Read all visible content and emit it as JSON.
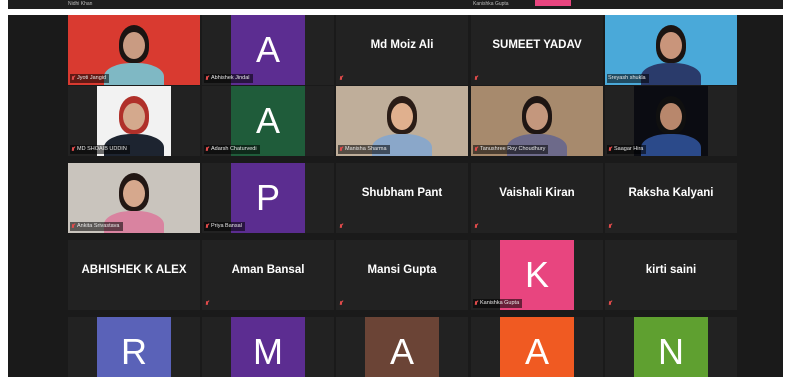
{
  "top_strip": {
    "names": [
      "Nidhi Khan",
      "Kanishka Gupta"
    ],
    "accent_color": "#e8457f"
  },
  "participants": [
    {
      "id": "jyoti-jangid",
      "name": "Jyoti Jangid",
      "display": "video",
      "muted": true,
      "scene": {
        "bg": "#d93a30",
        "skin": "#c99b82",
        "hair": "#1b1412",
        "top": "#7fb8c4"
      }
    },
    {
      "id": "abhishek-jindal",
      "name": "Abhishek Jindal",
      "display": "avatar",
      "initial": "A",
      "color": "#5c2d91",
      "muted": true
    },
    {
      "id": "md-moiz-ali",
      "name": "Md Moiz Ali",
      "display": "name",
      "muted": true
    },
    {
      "id": "sumeet-yadav",
      "name": "SUMEET YADAV",
      "display": "name",
      "muted": true
    },
    {
      "id": "sreyash-shukla",
      "name": "Sreyash shukla",
      "display": "video",
      "muted": false,
      "active_speaker": true,
      "scene": {
        "bg": "#4aa9d9",
        "skin": "#c9957b",
        "hair": "#1b1412",
        "top": "#2a3b6b"
      }
    },
    {
      "id": "md-shoaib-uddin",
      "name": "MD SHOAIB UDDIN",
      "display": "video",
      "muted": true,
      "scene": {
        "bg": "#f2f2f2",
        "skin": "#d4a98d",
        "hair": "#b0302a",
        "top": "#1d2430"
      }
    },
    {
      "id": "adarsh-chaturvedi",
      "name": "Adarsh Chaturvedi",
      "display": "avatar",
      "initial": "A",
      "color": "#1f5c3a",
      "muted": true
    },
    {
      "id": "manisha-sharma",
      "name": "Manisha Sharma",
      "display": "video",
      "muted": true,
      "scene": {
        "bg": "#bfae9a",
        "skin": "#e0b08e",
        "hair": "#2a1c16",
        "top": "#8aa7c9"
      }
    },
    {
      "id": "tanushree-roy-choudhury",
      "name": "Tanushree Roy Choudhury",
      "display": "video",
      "muted": true,
      "scene": {
        "bg": "#a78a6d",
        "skin": "#c4977d",
        "hair": "#1e1513",
        "top": "#6d6a8a"
      }
    },
    {
      "id": "saagar-hira",
      "name": "Saagar Hira",
      "display": "video",
      "muted": true,
      "scene": {
        "bg": "#0b0c12",
        "skin": "#b8876c",
        "hair": "#101010",
        "top": "#2b4a8a"
      }
    },
    {
      "id": "ankita-srivastava",
      "name": "Ankita Srivastava",
      "display": "video",
      "muted": true,
      "scene": {
        "bg": "#c9c4bd",
        "skin": "#d6a88d",
        "hair": "#221714",
        "top": "#d983a0"
      }
    },
    {
      "id": "priya-bansal",
      "name": "Priya Bansal",
      "display": "avatar",
      "initial": "P",
      "color": "#5b2d90",
      "muted": true
    },
    {
      "id": "shubham-pant",
      "name": "Shubham Pant",
      "display": "name",
      "muted": true
    },
    {
      "id": "vaishali-kiran",
      "name": "Vaishali Kiran",
      "display": "name",
      "muted": true
    },
    {
      "id": "raksha-kalyani",
      "name": "Raksha Kalyani",
      "display": "name",
      "muted": true
    },
    {
      "id": "abhishek-k-alex",
      "name": "ABHISHEK K ALEX",
      "display": "name",
      "muted": false
    },
    {
      "id": "aman-bansal",
      "name": "Aman Bansal",
      "display": "name",
      "muted": true
    },
    {
      "id": "mansi-gupta",
      "name": "Mansi Gupta",
      "display": "name",
      "muted": true
    },
    {
      "id": "kanishka-gupta",
      "name": "Kanishka Gupta",
      "display": "avatar",
      "initial": "K",
      "color": "#e8457f",
      "muted": true
    },
    {
      "id": "kirti-saini",
      "name": "kirti saini",
      "display": "name",
      "muted": true
    },
    {
      "id": "r-participant",
      "name": "",
      "display": "avatar",
      "initial": "R",
      "color": "#5a62b8",
      "muted": false
    },
    {
      "id": "m-participant",
      "name": "",
      "display": "avatar",
      "initial": "M",
      "color": "#5c2d91",
      "muted": false
    },
    {
      "id": "a-participant-brown",
      "name": "",
      "display": "avatar",
      "initial": "A",
      "color": "#6b4436",
      "muted": false
    },
    {
      "id": "a-participant-orange",
      "name": "",
      "display": "avatar",
      "initial": "A",
      "color": "#f05a22",
      "muted": false
    },
    {
      "id": "n-participant",
      "name": "",
      "display": "avatar",
      "initial": "N",
      "color": "#5fa030",
      "muted": false
    }
  ]
}
